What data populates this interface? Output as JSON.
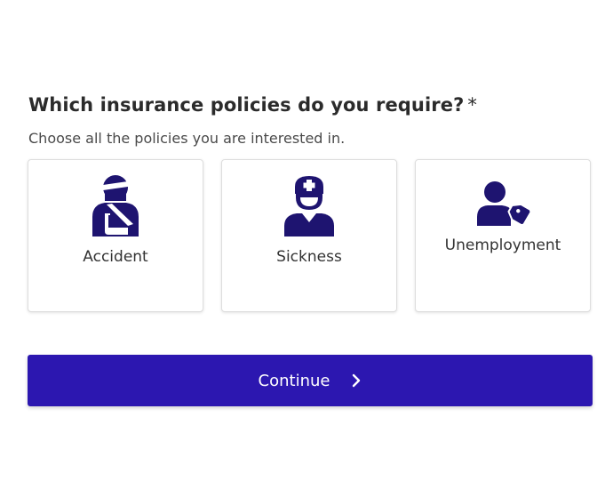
{
  "question": {
    "title": "Which insurance policies do you require?",
    "required_marker": "*",
    "subtitle": "Choose all the policies you are interested in."
  },
  "options": [
    {
      "label": "Accident",
      "icon": "injured-person-icon"
    },
    {
      "label": "Sickness",
      "icon": "nurse-icon"
    },
    {
      "label": "Unemployment",
      "icon": "person-tag-icon"
    }
  ],
  "continue_button": {
    "label": "Continue",
    "icon": "chevron-right-icon"
  },
  "colors": {
    "primary": "#2c17b0",
    "icon": "#1e1470",
    "text": "#2b2b2b"
  }
}
